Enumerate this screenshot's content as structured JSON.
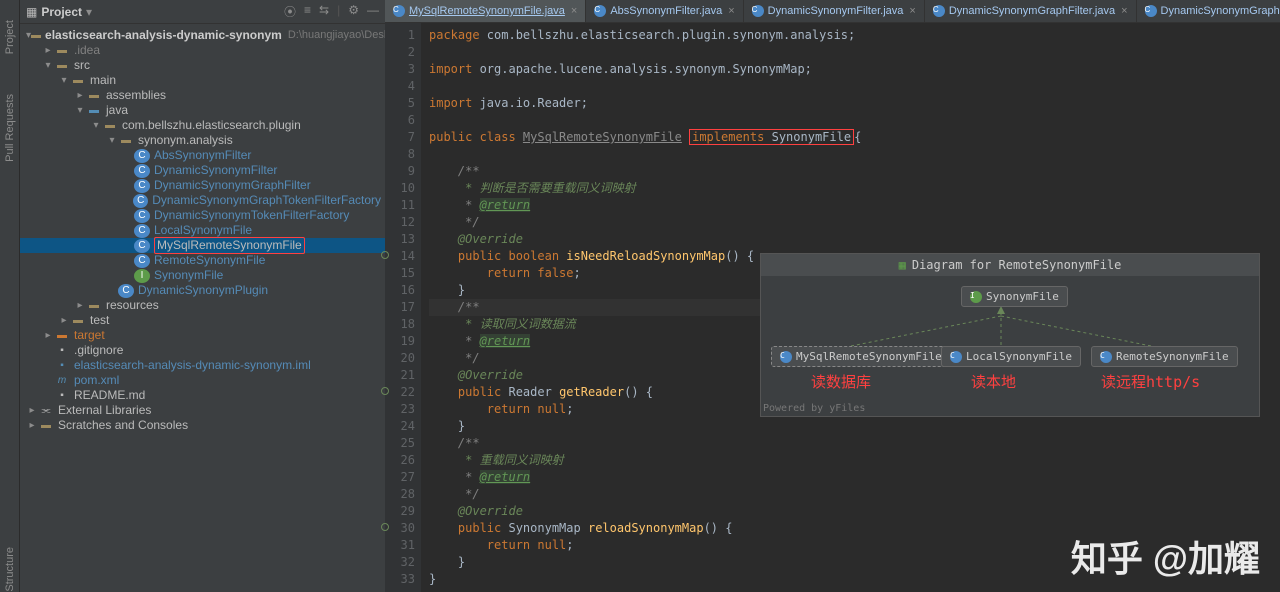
{
  "rails": {
    "project": "Project",
    "pullreq": "Pull Requests",
    "structure": "Structure"
  },
  "sidebar": {
    "title": "Project",
    "rootPath": "D:\\huangjiayao\\Desktop\\elastic...",
    "root": "elasticsearch-analysis-dynamic-synonym",
    "idea": ".idea",
    "src": "src",
    "main": "main",
    "assemblies": "assemblies",
    "java": "java",
    "pkg": "com.bellszhu.elasticsearch.plugin",
    "subpkg": "synonym.analysis",
    "files": [
      "AbsSynonymFilter",
      "DynamicSynonymFilter",
      "DynamicSynonymGraphFilter",
      "DynamicSynonymGraphTokenFilterFactory",
      "DynamicSynonymTokenFilterFactory",
      "LocalSynonymFile",
      "MySqlRemoteSynonymFile",
      "RemoteSynonymFile",
      "SynonymFile"
    ],
    "plugin": "DynamicSynonymPlugin",
    "resources": "resources",
    "test": "test",
    "target": "target",
    "gitignore": ".gitignore",
    "iml": "elasticsearch-analysis-dynamic-synonym.iml",
    "pom": "pom.xml",
    "readme": "README.md",
    "extlib": "External Libraries",
    "scratches": "Scratches and Consoles"
  },
  "tabs": [
    {
      "label": "MySqlRemoteSynonymFile.java",
      "active": true
    },
    {
      "label": "AbsSynonymFilter.java"
    },
    {
      "label": "DynamicSynonymFilter.java"
    },
    {
      "label": "DynamicSynonymGraphFilter.java"
    },
    {
      "label": "DynamicSynonymGraphTokenFilterFactory.java"
    }
  ],
  "code": {
    "l1": "package com.bellszhu.elasticsearch.plugin.synonym.analysis;",
    "l3a": "import ",
    "l3b": "org.apache.lucene.analysis.synonym.SynonymMap;",
    "l5a": "import ",
    "l5b": "java.io.Reader;",
    "l7a": "public class ",
    "l7b": "MySqlRemoteSynonymFile",
    "l7c": " implements ",
    "l7d": "SynonymFile",
    "l7e": "{",
    "l9": "    /**",
    "l10": "     * 判断是否需要重载同义词映射",
    "l11a": "     * ",
    "l11b": "@return",
    "l12": "     */",
    "l13": "    @Override",
    "l14a": "    public boolean ",
    "l14b": "isNeedReloadSynonymMap",
    "l14c": "() {",
    "l15a": "        return ",
    "l15b": "false",
    "l15c": ";",
    "l16": "    }",
    "l17": "    /**",
    "l18": "     * 读取同义词数据流",
    "l19a": "     * ",
    "l19b": "@return",
    "l20": "     */",
    "l21": "    @Override",
    "l22a": "    public ",
    "l22b": "Reader ",
    "l22c": "getReader",
    "l22d": "() {",
    "l23a": "        return null",
    "l23b": ";",
    "l24": "    }",
    "l25": "    /**",
    "l26": "     * 重载同义词映射",
    "l27a": "     * ",
    "l27b": "@return",
    "l28": "     */",
    "l29": "    @Override",
    "l30a": "    public ",
    "l30b": "SynonymMap ",
    "l30c": "reloadSynonymMap",
    "l30d": "() {",
    "l31a": "        return null",
    "l31b": ";",
    "l32": "    }",
    "l33": "}"
  },
  "diagram": {
    "title": "Diagram for RemoteSynonymFile",
    "parent": "SynonymFile",
    "c1": "MySqlRemoteSynonymFile",
    "c2": "LocalSynonymFile",
    "c3": "RemoteSynonymFile",
    "t1": "读数据库",
    "t2": "读本地",
    "t3": "读远程http/s",
    "powered": "Powered by yFiles"
  },
  "watermark": "知乎 @加耀"
}
